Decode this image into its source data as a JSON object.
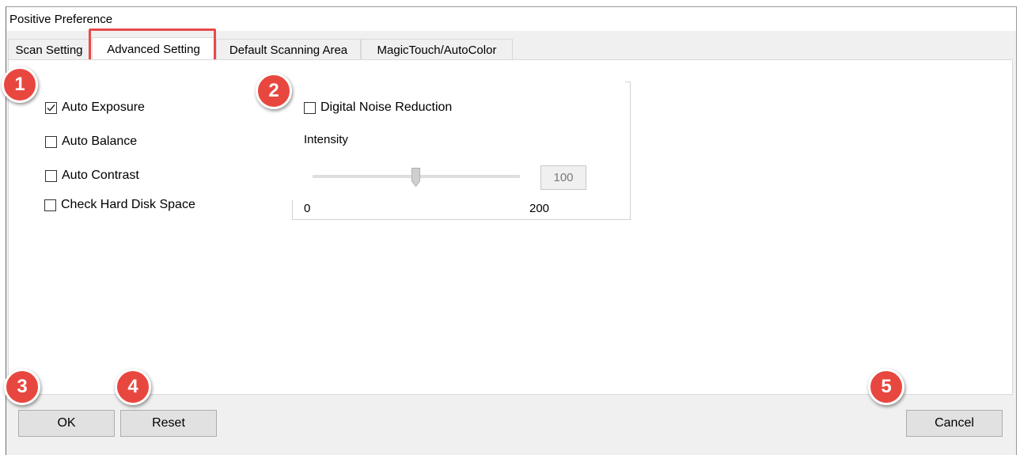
{
  "window": {
    "title": "Positive Preference"
  },
  "tabs": [
    {
      "label": "Scan Setting"
    },
    {
      "label": "Advanced Setting"
    },
    {
      "label": "Default Scanning Area"
    },
    {
      "label": "MagicTouch/AutoColor"
    }
  ],
  "options": {
    "auto_exposure": {
      "label": "Auto Exposure",
      "checked": true
    },
    "auto_balance": {
      "label": "Auto Balance",
      "checked": false
    },
    "auto_contrast": {
      "label": "Auto Contrast",
      "checked": false
    },
    "check_disk": {
      "label": "Check Hard Disk Space",
      "checked": false
    }
  },
  "noise": {
    "label": "Digital Noise Reduction",
    "checked": false,
    "intensity_label": "Intensity",
    "min": "0",
    "max": "200",
    "value": "100"
  },
  "buttons": {
    "ok": "OK",
    "reset": "Reset",
    "cancel": "Cancel"
  },
  "badges": [
    "1",
    "2",
    "3",
    "4",
    "5"
  ],
  "colors": {
    "badge": "#e8473f",
    "highlight": "#e84a4a"
  }
}
